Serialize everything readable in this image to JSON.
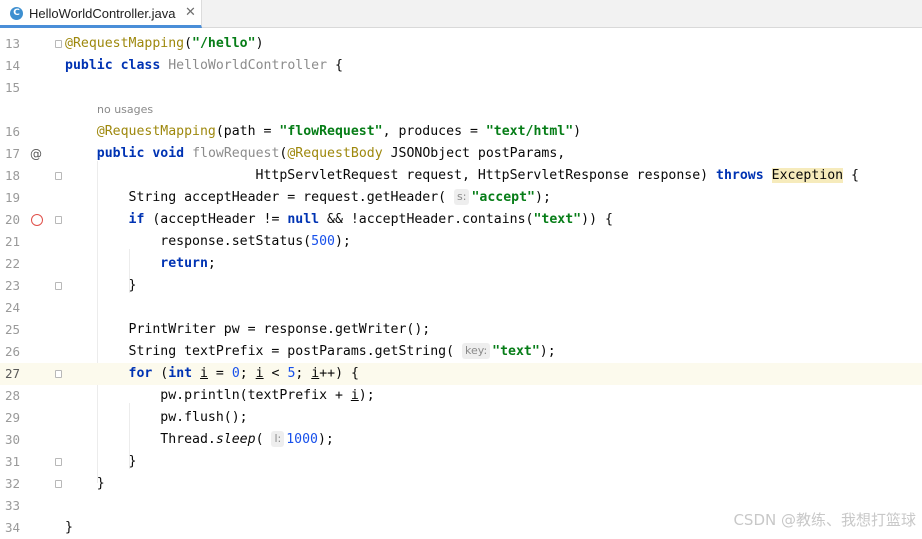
{
  "tab": {
    "icon_letter": "C",
    "title": "HelloWorldController.java",
    "close": "✕"
  },
  "editor": {
    "line_numbers": [
      "13",
      "14",
      "15",
      "",
      "16",
      "17",
      "18",
      "19",
      "20",
      "21",
      "22",
      "23",
      "24",
      "25",
      "26",
      "27",
      "28",
      "29",
      "30",
      "31",
      "32",
      "33",
      "34"
    ],
    "inlay_no_usages": "no usages",
    "hint_s": "s:",
    "hint_key": "key:",
    "hint_l": "l:",
    "gutter_at": "@",
    "watermark": "CSDN @教练、我想打篮球"
  }
}
